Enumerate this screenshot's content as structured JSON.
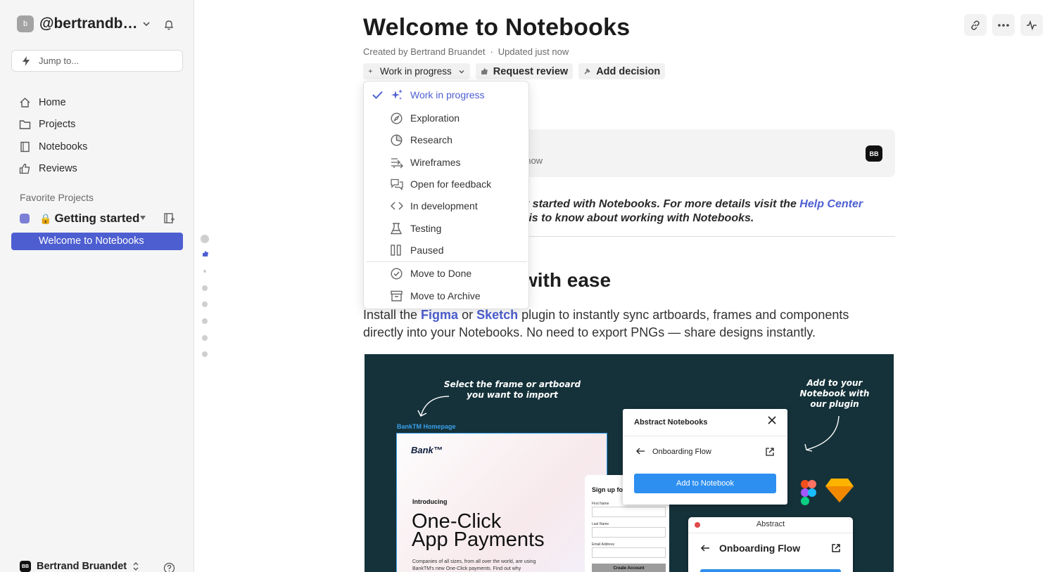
{
  "sidebar": {
    "workspace_initial": "b",
    "workspace_name": "@bertrandbruandet",
    "jump_placeholder": "Jump to...",
    "nav": [
      {
        "label": "Home",
        "icon": "home-icon"
      },
      {
        "label": "Projects",
        "icon": "folder-icon"
      },
      {
        "label": "Notebooks",
        "icon": "notebook-icon"
      },
      {
        "label": "Reviews",
        "icon": "thumbs-up-icon"
      }
    ],
    "favorites_heading": "Favorite Projects",
    "project": {
      "lock": "🔒",
      "name": "Getting started",
      "color": "#7b7fd6"
    },
    "active_item": "Welcome to Notebooks",
    "user": {
      "initials": "BB",
      "name": "Bertrand Bruandet"
    }
  },
  "page": {
    "title": "Welcome to Notebooks",
    "created_by": "Created by Bertrand Bruandet",
    "separator": "·",
    "updated": "Updated just now",
    "status_chip": "Work in progress",
    "request_review": "Request review",
    "add_decision": "Add decision",
    "card_initials": "BB",
    "card_time": "t now",
    "intro_line1_a": "et started with Notebooks. For more details visit the ",
    "intro_link": "Help Center",
    "intro_line2": "e is to know about working with Notebooks.",
    "heading": "with ease",
    "para_a": "Install the ",
    "para_figma": "Figma",
    "para_or": " or ",
    "para_sketch": "Sketch",
    "para_b": " plugin to instantly sync artboards, frames and components directly into your Notebooks. No need to export PNGs — share designs instantly."
  },
  "status_menu": {
    "items": [
      {
        "label": "Work in progress",
        "icon": "sparkle-icon",
        "selected": true
      },
      {
        "label": "Exploration",
        "icon": "compass-icon"
      },
      {
        "label": "Research",
        "icon": "pie-chart-icon"
      },
      {
        "label": "Wireframes",
        "icon": "wireframe-arrow-icon"
      },
      {
        "label": "Open for feedback",
        "icon": "chat-bubbles-icon"
      },
      {
        "label": "In development",
        "icon": "code-icon"
      },
      {
        "label": "Testing",
        "icon": "flask-icon"
      },
      {
        "label": "Paused",
        "icon": "pause-icon"
      },
      {
        "label": "Move to Done",
        "icon": "check-circle-icon"
      },
      {
        "label": "Move to Archive",
        "icon": "archive-icon"
      }
    ]
  },
  "illustration": {
    "callout_left": "Select the frame or artboard\nyou want to import",
    "callout_right": "Add to your\nNotebook with\nour plugin",
    "artboard_label": "BankTM Homepage",
    "bank_logo": "Bank™",
    "introducing": "Introducing",
    "headline1": "One-Click",
    "headline2": "App Payments",
    "body_small": "Companies of all sizes, from all over the world, are using BankTM's new One-Click payments. Find out why",
    "signup_title": "Sign up fo",
    "field1": "First Name",
    "field2": "Last Name",
    "field3": "Email Address",
    "create_account": "Create Account",
    "plugin_title": "Abstract Notebooks",
    "plugin_flow": "Onboarding Flow",
    "plugin_button": "Add to Notebook",
    "app_title": "Abstract",
    "app_flow": "Onboarding Flow",
    "colors": {
      "background": "#15323a",
      "accent": "#2d8ff0",
      "brand": "#4d5ed1"
    }
  }
}
